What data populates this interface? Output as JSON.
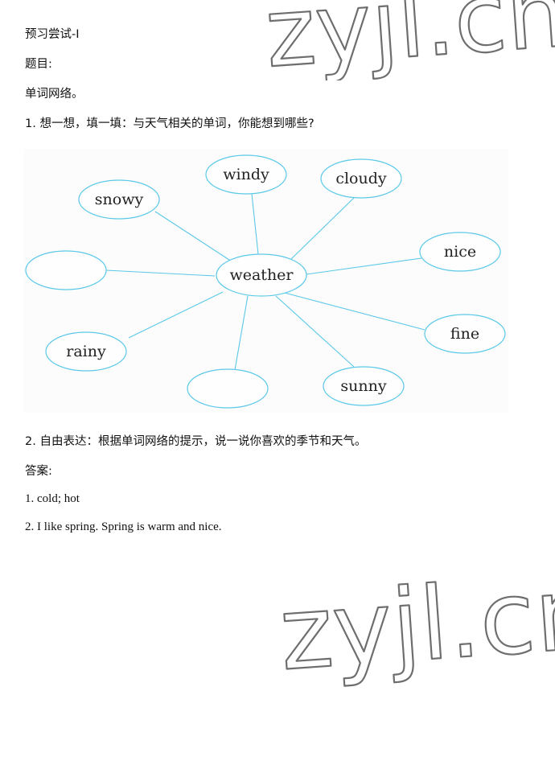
{
  "document": {
    "title": "预习尝试-I",
    "question_label": "题目:",
    "topic": "单词网络。",
    "q1": "1. 想一想，填一填：与天气相关的单词，你能想到哪些?",
    "q2": "2. 自由表达：根据单词网络的提示，说一说你喜欢的季节和天气。",
    "answer_label": "答案:",
    "a1": "1. cold; hot",
    "a2": "2. I like spring. Spring is warm and nice."
  },
  "diagram": {
    "center": "weather",
    "line_color": "#5bc8e8",
    "nodes": [
      {
        "id": "snowy",
        "label": "snowy"
      },
      {
        "id": "windy",
        "label": "windy"
      },
      {
        "id": "cloudy",
        "label": "cloudy"
      },
      {
        "id": "nice",
        "label": "nice"
      },
      {
        "id": "blank-left",
        "label": ""
      },
      {
        "id": "fine",
        "label": "fine"
      },
      {
        "id": "rainy",
        "label": "rainy"
      },
      {
        "id": "blank-bottom",
        "label": ""
      },
      {
        "id": "sunny",
        "label": "sunny"
      }
    ]
  },
  "watermark": {
    "text": "zyjl.cn"
  }
}
